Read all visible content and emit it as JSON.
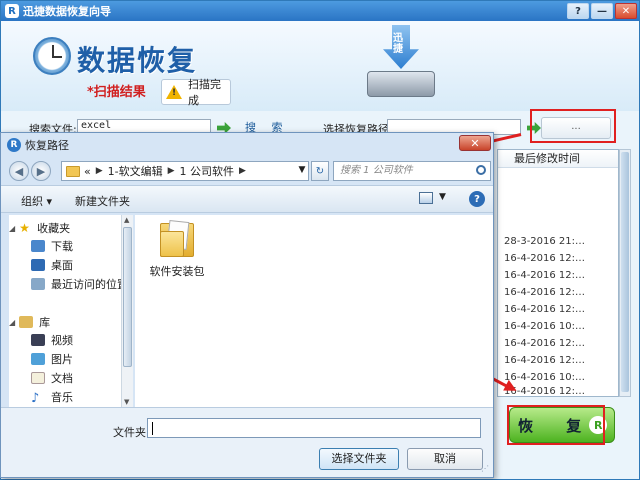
{
  "app": {
    "title": "迅捷数据恢复向导",
    "logo_letter": "R",
    "heading": "数据恢复",
    "scan_result": "*扫描结果",
    "scan_done": "扫描完成",
    "drive_label": "迅捷",
    "window_controls": {
      "help": "?",
      "minimize": "—",
      "close": "✕"
    },
    "search": {
      "label": "搜索文件:",
      "value": "excel",
      "button": "搜 索"
    },
    "restore_path": {
      "label": "选择恢复路径",
      "value": "",
      "browse_button": "..."
    },
    "results": {
      "column_header": "最后修改时间",
      "rows": [
        "28-3-2016 21:…",
        "16-4-2016 12:…",
        "16-4-2016 12:…",
        "16-4-2016 12:…",
        "16-4-2016 12:…",
        "16-4-2016 10:…",
        "16-4-2016 12:…",
        "16-4-2016 12:…",
        "16-4-2016 10:…",
        "16-4-2016 12:…"
      ]
    },
    "recover_button": "恢 复",
    "recover_icon_letter": "R",
    "accent_color": "#2a74c4",
    "highlight_color": "#e02020"
  },
  "dialog": {
    "title": "恢复路径",
    "logo_letter": "R",
    "close": "✕",
    "back": "◀",
    "forward": "▶",
    "breadcrumb": {
      "prefix": "«",
      "items": [
        "1-软文编辑",
        "1 公司软件"
      ]
    },
    "search_placeholder": "搜索 1 公司软件",
    "toolbar": {
      "organize": "组织 ▾",
      "new_folder": "新建文件夹"
    },
    "nav_pane": {
      "favorites": "收藏夹",
      "favorites_items": [
        "下载",
        "桌面",
        "最近访问的位置"
      ],
      "libraries": "库",
      "library_items": [
        "视频",
        "图片",
        "文档",
        "音乐"
      ]
    },
    "files": [
      {
        "name": "软件安装包",
        "icon": "folder-icon"
      }
    ],
    "folder_label": "文件夹:",
    "folder_value": "",
    "select_button": "选择文件夹",
    "cancel_button": "取消"
  }
}
